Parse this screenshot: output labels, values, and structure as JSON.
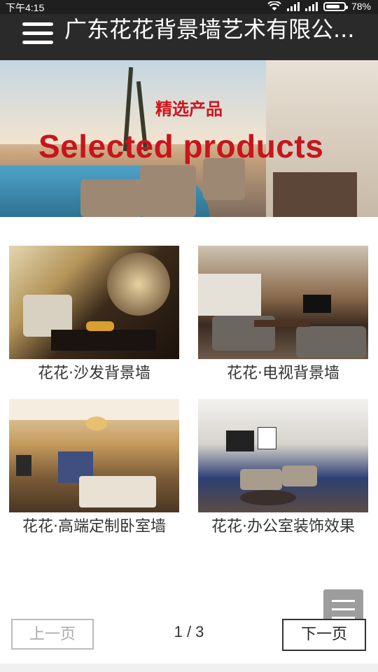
{
  "status_bar": {
    "time": "下午4:15",
    "battery": "78%",
    "battery_level": 0.78,
    "icons": [
      "wifi-icon",
      "signal-icon",
      "signal-icon",
      "battery-icon"
    ]
  },
  "header": {
    "title": "广东花花背景墙艺术有限公...",
    "menu_icon": "hamburger-menu-icon"
  },
  "banner": {
    "subtitle": "精选产品",
    "headline": "Selected products"
  },
  "products": [
    {
      "name": "花花·沙发背景墙"
    },
    {
      "name": "花花·电视背景墙"
    },
    {
      "name": "花花·高端定制卧室墙"
    },
    {
      "name": "花花·办公室装饰效果"
    }
  ],
  "pagination": {
    "prev_label": "上一页",
    "next_label": "下一页",
    "page_indicator": "1 / 3"
  },
  "floating_menu": {
    "icon": "menu-icon"
  },
  "colors": {
    "header_bg": "#2a2a2a",
    "headline_red": "#c8141c"
  }
}
